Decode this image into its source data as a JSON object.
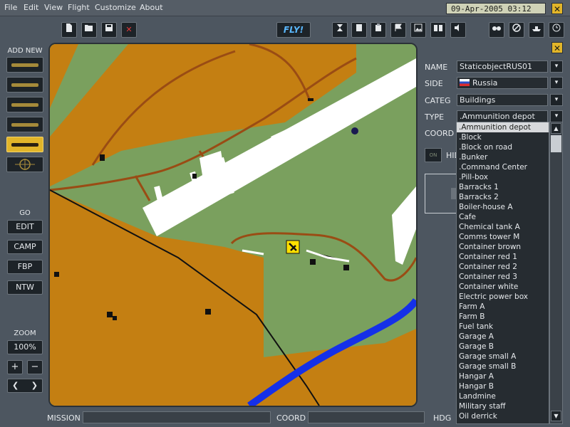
{
  "menu": {
    "items": [
      "File",
      "Edit",
      "View",
      "Flight",
      "Customize",
      "About"
    ],
    "datetime": "09-Apr-2005   03:12",
    "close": "✕"
  },
  "toolbar": {
    "fly_label": "FLY!",
    "delete": "✕"
  },
  "left_panel": {
    "add_new_label": "ADD NEW",
    "go_label": "GO",
    "go_buttons": [
      "EDIT",
      "CAMP",
      "FBP",
      "NTW"
    ],
    "zoom_label": "ZOOM",
    "zoom_value": "100%",
    "zoom_in": "+",
    "zoom_out": "−",
    "prev": "❮",
    "next": "❯"
  },
  "properties": {
    "close": "✕",
    "name_label": "NAME",
    "name_value": "StaticobjectRUS01",
    "side_label": "SIDE",
    "side_value": "Russia",
    "categ_label": "CATEG",
    "categ_value": "Buildings",
    "type_label": "TYPE",
    "type_value": ".Ammunition depot",
    "coord_label": "COORD",
    "hide_label": "HID",
    "on_label": "ON"
  },
  "type_list": [
    ".Ammunition depot",
    ".Block",
    ".Block on road",
    ".Bunker",
    ".Command Center",
    ".Pill-box",
    "Barracks 1",
    "Barracks 2",
    "Boiler-house A",
    "Cafe",
    "Chemical tank A",
    "Comms tower M",
    "Container brown",
    "Container red 1",
    "Container red 2",
    "Container red 3",
    "Container white",
    "Electric power box",
    "Farm A",
    "Farm B",
    "Fuel tank",
    "Garage A",
    "Garage B",
    "Garage small A",
    "Garage small B",
    "Hangar A",
    "Hangar B",
    "Landmine",
    "Military staff",
    "Oil derrick"
  ],
  "bottom": {
    "mission_label": "MISSION",
    "coord_label": "COORD",
    "hdg_label": "HDG"
  },
  "colors": {
    "grass": "#7aa05e",
    "field": "#c47f12",
    "road": "#9a4c14",
    "water": "#1530e8",
    "accent": "#e2b529"
  }
}
